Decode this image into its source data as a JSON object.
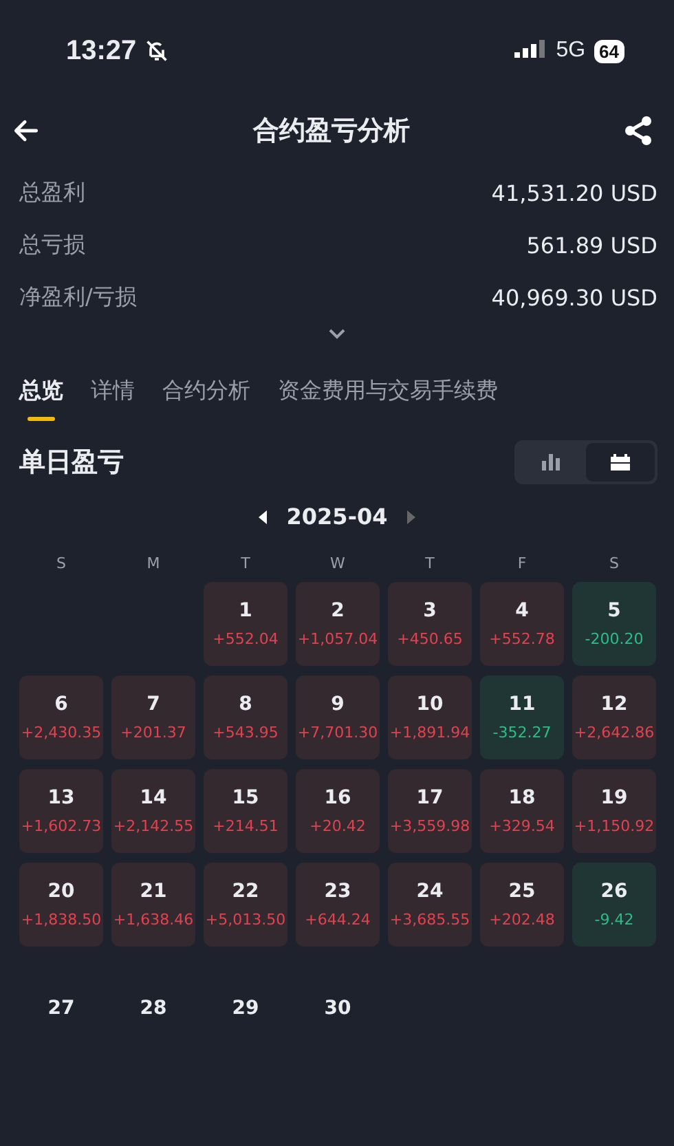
{
  "status_bar": {
    "time": "13:27",
    "network": "5G",
    "battery": "64"
  },
  "header": {
    "title": "合约盈亏分析"
  },
  "summary": [
    {
      "label": "总盈利",
      "value": "41,531.20 USD"
    },
    {
      "label": "总亏损",
      "value": "561.89 USD"
    },
    {
      "label": "净盈利/亏损",
      "value": "40,969.30 USD"
    }
  ],
  "tabs": [
    {
      "label": "总览",
      "selected": true
    },
    {
      "label": "详情",
      "selected": false
    },
    {
      "label": "合约分析",
      "selected": false
    },
    {
      "label": "资金费用与交易手续费",
      "selected": false
    }
  ],
  "section": {
    "title": "单日盈亏",
    "views": [
      {
        "kind": "chart",
        "selected": false
      },
      {
        "kind": "calendar",
        "selected": true
      }
    ]
  },
  "month": "2025-04",
  "weekdays": [
    "S",
    "M",
    "T",
    "W",
    "T",
    "F",
    "S"
  ],
  "days": [
    {
      "kind": "blank"
    },
    {
      "kind": "blank"
    },
    {
      "kind": "profit",
      "day": "1",
      "pnl": "+552.04"
    },
    {
      "kind": "profit",
      "day": "2",
      "pnl": "+1,057.04"
    },
    {
      "kind": "profit",
      "day": "3",
      "pnl": "+450.65"
    },
    {
      "kind": "profit",
      "day": "4",
      "pnl": "+552.78"
    },
    {
      "kind": "loss",
      "day": "5",
      "pnl": "-200.20"
    },
    {
      "kind": "profit",
      "day": "6",
      "pnl": "+2,430.35"
    },
    {
      "kind": "profit",
      "day": "7",
      "pnl": "+201.37"
    },
    {
      "kind": "profit",
      "day": "8",
      "pnl": "+543.95"
    },
    {
      "kind": "profit",
      "day": "9",
      "pnl": "+7,701.30"
    },
    {
      "kind": "profit",
      "day": "10",
      "pnl": "+1,891.94"
    },
    {
      "kind": "loss",
      "day": "11",
      "pnl": "-352.27"
    },
    {
      "kind": "profit",
      "day": "12",
      "pnl": "+2,642.86"
    },
    {
      "kind": "profit",
      "day": "13",
      "pnl": "+1,602.73"
    },
    {
      "kind": "profit",
      "day": "14",
      "pnl": "+2,142.55"
    },
    {
      "kind": "profit",
      "day": "15",
      "pnl": "+214.51"
    },
    {
      "kind": "profit",
      "day": "16",
      "pnl": "+20.42"
    },
    {
      "kind": "profit",
      "day": "17",
      "pnl": "+3,559.98"
    },
    {
      "kind": "profit",
      "day": "18",
      "pnl": "+329.54"
    },
    {
      "kind": "profit",
      "day": "19",
      "pnl": "+1,150.92"
    },
    {
      "kind": "profit",
      "day": "20",
      "pnl": "+1,838.50"
    },
    {
      "kind": "profit",
      "day": "21",
      "pnl": "+1,638.46"
    },
    {
      "kind": "profit",
      "day": "22",
      "pnl": "+5,013.50"
    },
    {
      "kind": "profit",
      "day": "23",
      "pnl": "+644.24"
    },
    {
      "kind": "profit",
      "day": "24",
      "pnl": "+3,685.55"
    },
    {
      "kind": "profit",
      "day": "25",
      "pnl": "+202.48"
    },
    {
      "kind": "loss",
      "day": "26",
      "pnl": "-9.42"
    },
    {
      "kind": "future",
      "day": "27"
    },
    {
      "kind": "future",
      "day": "28"
    },
    {
      "kind": "future",
      "day": "29"
    },
    {
      "kind": "future",
      "day": "30"
    }
  ]
}
